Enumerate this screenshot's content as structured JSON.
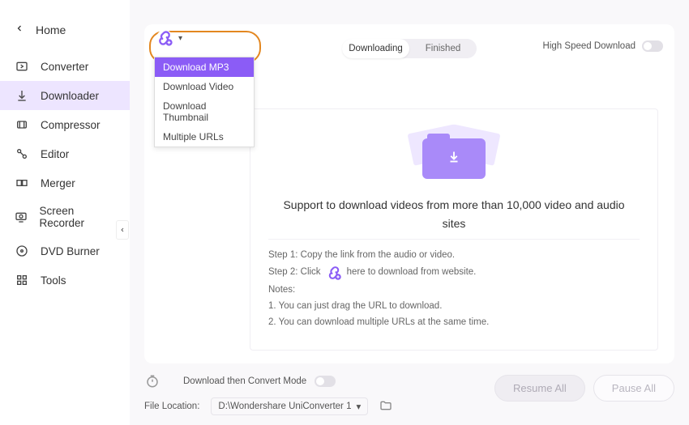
{
  "home_label": "Home",
  "sidebar": {
    "items": [
      {
        "label": "Converter"
      },
      {
        "label": "Downloader"
      },
      {
        "label": "Compressor"
      },
      {
        "label": "Editor"
      },
      {
        "label": "Merger"
      },
      {
        "label": "Screen Recorder"
      },
      {
        "label": "DVD Burner"
      },
      {
        "label": "Tools"
      }
    ]
  },
  "dropdown": {
    "items": [
      {
        "label": "Download MP3"
      },
      {
        "label": "Download Video"
      },
      {
        "label": "Download Thumbnail"
      },
      {
        "label": "Multiple URLs"
      }
    ]
  },
  "segmented": {
    "downloading": "Downloading",
    "finished": "Finished"
  },
  "hsd_label": "High Speed Download",
  "empty": {
    "headline_l1": "Support to download videos from more than 10,000 video and audio",
    "headline_l2": "sites",
    "step1": "Step 1: Copy the link from the audio or video.",
    "step2_a": "Step 2: Click",
    "step2_b": "here to download from website.",
    "notes_label": "Notes:",
    "note1": "1. You can just drag the URL to download.",
    "note2": "2. You can download multiple URLs at the same time."
  },
  "footer": {
    "convert_mode": "Download then Convert Mode",
    "file_location_label": "File Location:",
    "file_location_value": "D:\\Wondershare UniConverter 1",
    "resume": "Resume All",
    "pause": "Pause All"
  }
}
